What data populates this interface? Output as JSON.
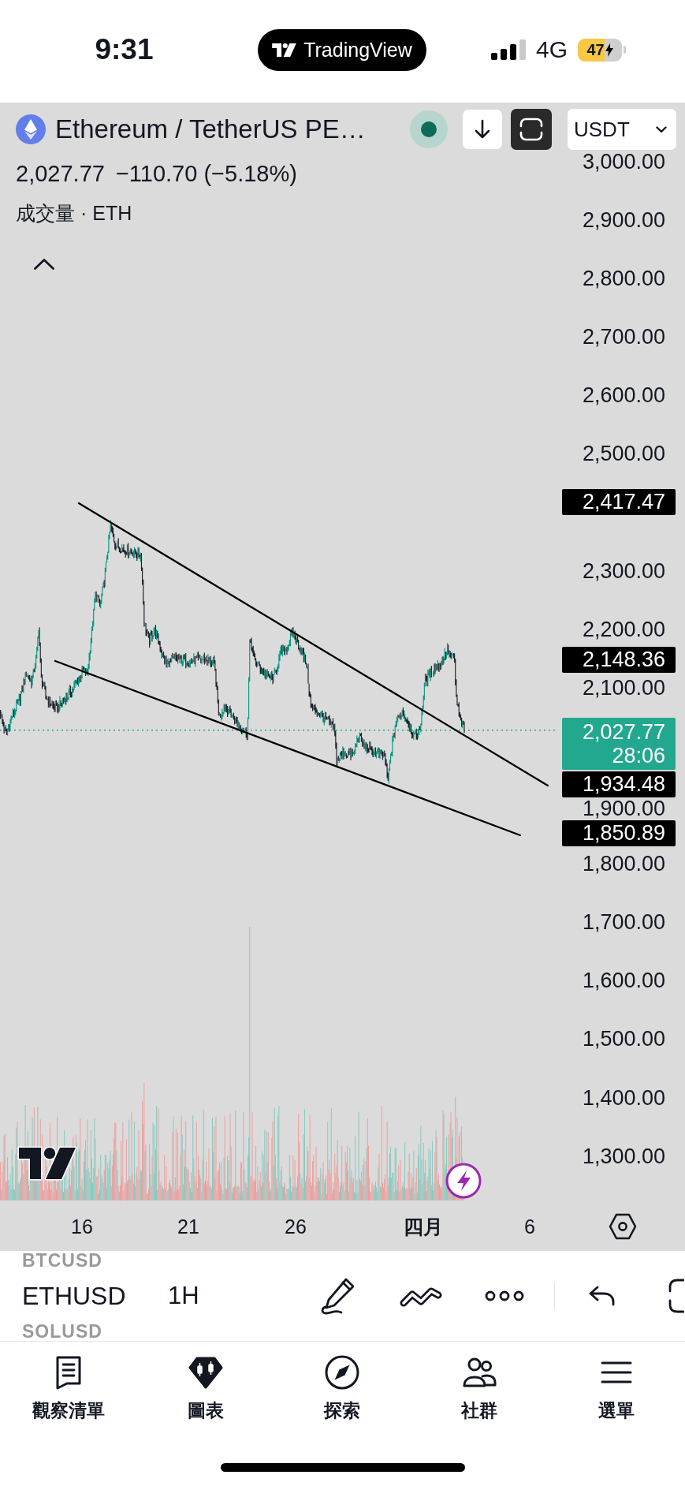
{
  "status_bar": {
    "time": "9:31",
    "app": "TradingView",
    "network": "4G",
    "battery": "47"
  },
  "symbol_bar": {
    "title": "Ethereum / TetherUS PE…",
    "currency": "USDT"
  },
  "legend": {
    "price": "2,027.77",
    "change": "−110.70 (−5.18%)",
    "volume": "成交量 · ETH"
  },
  "price_axis": {
    "ticks": [
      "3,000.00",
      "2,900.00",
      "2,800.00",
      "2,700.00",
      "2,600.00",
      "2,500.00",
      "2,300.00",
      "2,200.00",
      "2,100.00",
      "1,900.00",
      "1,800.00",
      "1,700.00",
      "1,600.00",
      "1,500.00",
      "1,400.00",
      "1,300.00"
    ]
  },
  "price_tags": [
    {
      "kind": "level",
      "text": "2,417.47"
    },
    {
      "kind": "level",
      "text": "2,148.36"
    },
    {
      "kind": "last",
      "text": "2,027.77",
      "countdown": "28:06"
    },
    {
      "kind": "level",
      "text": "1,934.48"
    },
    {
      "kind": "level",
      "text": "1,850.89"
    }
  ],
  "time_axis": {
    "labels": [
      {
        "kind": "day",
        "text": "16"
      },
      {
        "kind": "day",
        "text": "21"
      },
      {
        "kind": "day",
        "text": "26"
      },
      {
        "kind": "month",
        "text": "四月"
      },
      {
        "kind": "day",
        "text": "6"
      }
    ]
  },
  "toolbar": {
    "symbols": [
      {
        "text": "BTCUSD",
        "selected": false
      },
      {
        "text": "ETHUSD",
        "selected": true
      },
      {
        "text": "SOLUSD",
        "selected": false
      }
    ],
    "interval": "1H"
  },
  "nav": {
    "items": [
      {
        "kind": "watchlist",
        "label": "觀察清單",
        "selected": false
      },
      {
        "kind": "chart",
        "label": "圖表",
        "selected": true
      },
      {
        "kind": "explore",
        "label": "探索",
        "selected": false
      },
      {
        "kind": "community",
        "label": "社群",
        "selected": false
      },
      {
        "kind": "menu",
        "label": "選單",
        "selected": false
      }
    ]
  }
}
